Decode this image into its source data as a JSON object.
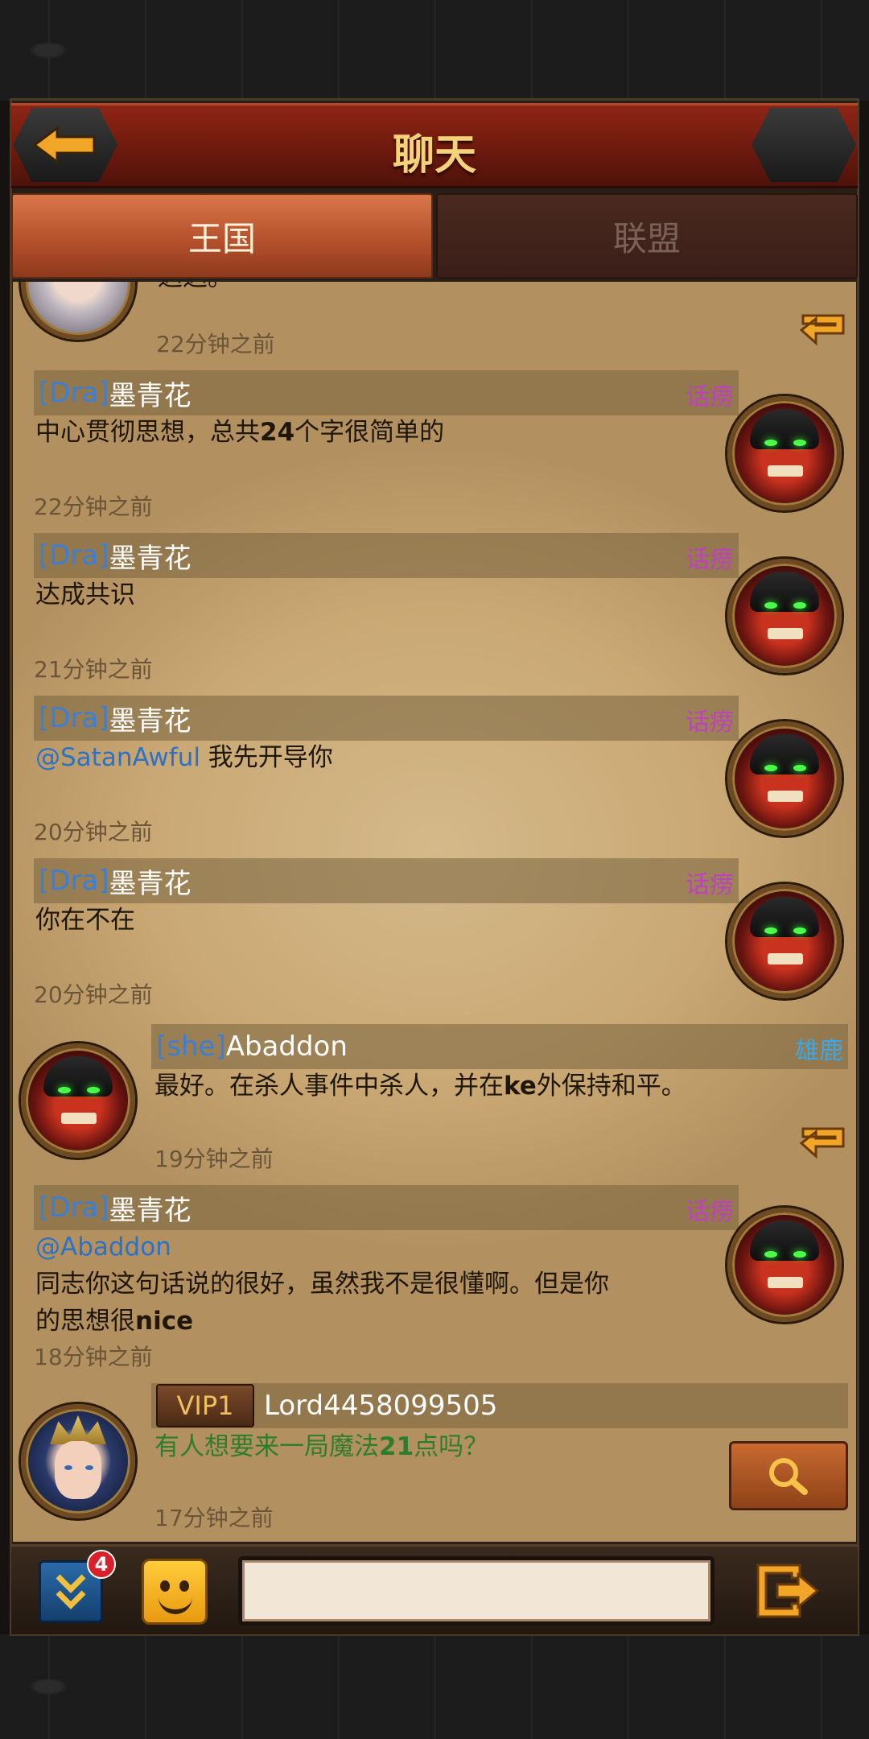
{
  "header": {
    "title": "聊天"
  },
  "tabs": [
    {
      "label": "王国",
      "active": true
    },
    {
      "label": "联盟",
      "active": false
    }
  ],
  "messages": [
    {
      "partial_text": "迟迟。",
      "time": "22分钟之前"
    },
    {
      "tag": "[Dra]",
      "name": "墨青花",
      "alliance": "话痨",
      "text_pre": "中心贯彻思想，总共",
      "text_bold": "24",
      "text_post": "个字很简单的",
      "time": "22分钟之前"
    },
    {
      "tag": "[Dra]",
      "name": "墨青花",
      "alliance": "话痨",
      "text": "达成共识",
      "time": "21分钟之前"
    },
    {
      "tag": "[Dra]",
      "name": "墨青花",
      "alliance": "话痨",
      "mention": "@SatanAwful",
      "text": " 我先开导你",
      "time": "20分钟之前"
    },
    {
      "tag": "[Dra]",
      "name": "墨青花",
      "alliance": "话痨",
      "text": "你在不在",
      "time": "20分钟之前"
    },
    {
      "tag": "[she]",
      "name": "Abaddon",
      "alliance": "雄鹿",
      "text_pre": "最好。在杀人事件中杀人，并在",
      "text_bold": "ke",
      "text_post": "外保持和平。",
      "time": "19分钟之前"
    },
    {
      "tag": "[Dra]",
      "name": "墨青花",
      "alliance": "话痨",
      "mention": "@Abaddon",
      "line1": "同志你这句话说的很好，虽然我不是很懂啊。但是你",
      "line2_pre": "的思想很",
      "line2_bold": "nice",
      "time": "18分钟之前"
    },
    {
      "vip": "VIP1",
      "name": "Lord4458099505",
      "text_pre": "有人想要来一局魔法",
      "text_bold": "21",
      "text_post": "点吗？",
      "time": "17分钟之前"
    }
  ],
  "toolbar": {
    "badge_count": "4",
    "input_placeholder": ""
  },
  "colors": {
    "header_red": "#8e2515",
    "tab_active": "#d9774a",
    "tag_blue": "#3a7fd8",
    "alliance_purple": "#c040c0",
    "alliance_blue": "#3aa8e8",
    "green_text": "#2e7d2e",
    "title_gold": "#f4d27a"
  },
  "icons": [
    "back-arrow-icon",
    "reply-icon",
    "search-icon",
    "collapse-icon",
    "emoji-icon",
    "send-icon"
  ]
}
